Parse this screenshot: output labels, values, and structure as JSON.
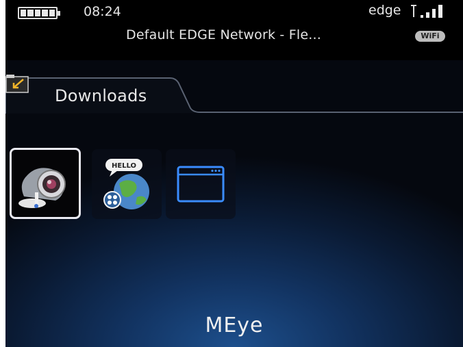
{
  "status_bar": {
    "time": "08:24",
    "network_name": "Default EDGE Network - Fle...",
    "carrier_mode": "edge",
    "wifi_badge": "WiFi",
    "battery_level": "full",
    "signal_bars": 4
  },
  "tab": {
    "label": "Downloads",
    "icon": "folder-icon"
  },
  "apps": [
    {
      "name": "webcam-app",
      "icon": "webcam-icon",
      "selected": true
    },
    {
      "name": "hello-globe-app",
      "icon": "hello-globe-icon",
      "badge_text": "HELLO",
      "selected": false
    },
    {
      "name": "browser-window-app",
      "icon": "browser-window-icon",
      "selected": false
    }
  ],
  "selected_app_title": "MEye",
  "colors": {
    "accent_blue": "#3a8cff",
    "background_dark": "#05080f",
    "text": "#e8e8e8"
  }
}
